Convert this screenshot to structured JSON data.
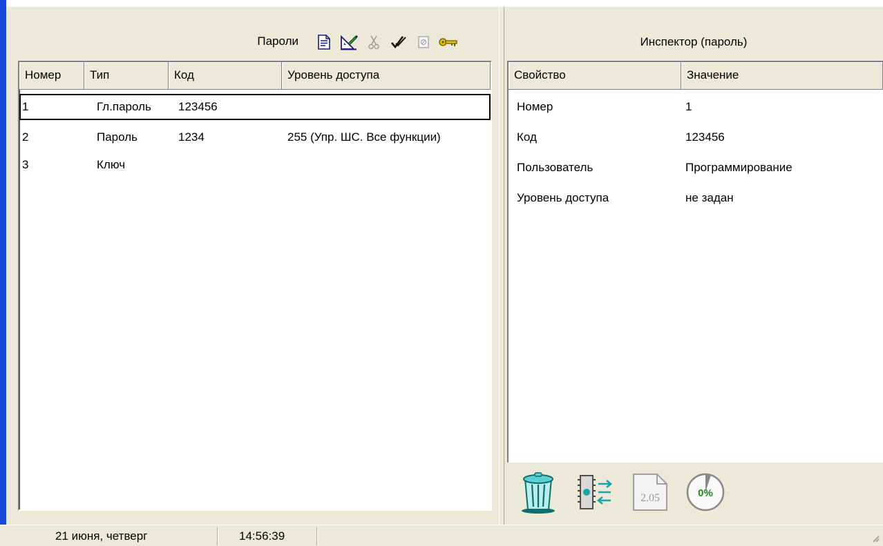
{
  "passwords_panel": {
    "title": "Пароли",
    "toolbar": [
      {
        "name": "new-document-icon"
      },
      {
        "name": "edit-properties-icon"
      },
      {
        "name": "cut-icon"
      },
      {
        "name": "check-icon"
      },
      {
        "name": "disabled-icon"
      },
      {
        "name": "key-icon"
      }
    ],
    "columns": [
      "Номер",
      "Тип",
      "Код",
      "Уровень доступа"
    ],
    "rows": [
      {
        "number": "1",
        "type": "Гл.пароль",
        "code": "123456",
        "access": ""
      },
      {
        "number": "2",
        "type": "Пароль",
        "code": "1234",
        "access": "255 (Упр. ШС. Все функции)"
      },
      {
        "number": "3",
        "type": "Ключ",
        "code": "",
        "access": ""
      }
    ],
    "selected_row": 0
  },
  "inspector": {
    "title": "Инспектор (пароль)",
    "columns": [
      "Свойство",
      "Значение"
    ],
    "properties": [
      {
        "name": "Номер",
        "value": "1"
      },
      {
        "name": "Код",
        "value": "123456"
      },
      {
        "name": "Пользователь",
        "value": "Программирование"
      },
      {
        "name": "Уровень доступа",
        "value": "не задан"
      }
    ],
    "tools": [
      {
        "name": "trash-icon"
      },
      {
        "name": "chip-transfer-icon"
      },
      {
        "name": "version-file-icon",
        "label": "2.05"
      },
      {
        "name": "progress-dial-icon",
        "label": "0%"
      }
    ]
  },
  "statusbar": {
    "date": "21 июня, четверг",
    "time": "14:56:39"
  },
  "colors": {
    "accent_bar": "#1747d6",
    "window_bg": "#ece9d8",
    "grid_bg": "#ffffff",
    "key_icon": "#e6c200",
    "teal_icon": "#16a6a6"
  }
}
